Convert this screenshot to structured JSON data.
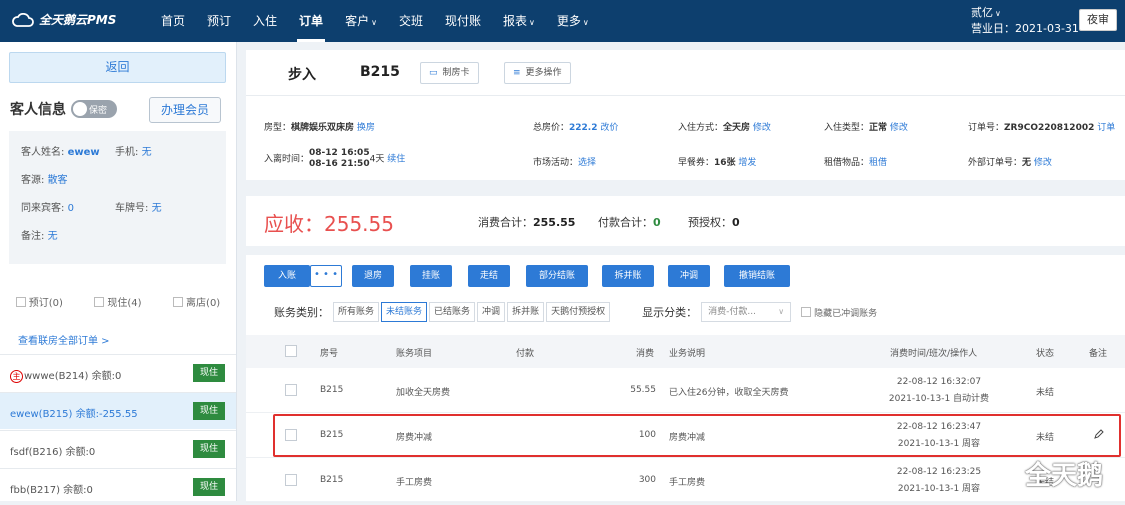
{
  "brand": {
    "name": "全天鹅云PMS"
  },
  "nav": [
    "首页",
    "预订",
    "入住",
    "订单",
    "客户",
    "交班",
    "现付账",
    "报表",
    "更多"
  ],
  "user": {
    "name": "贰亿",
    "business_date": "营业日：2021-03-31",
    "night_audit": "夜审"
  },
  "left": {
    "back": "返回",
    "guest_info": "客人信息",
    "privacy": "保密",
    "member": "办理会员",
    "name_label": "客人姓名:",
    "name": "ewew",
    "phone_label": "手机:",
    "phone": "无",
    "source_label": "客源:",
    "source": "散客",
    "companion_label": "同来宾客:",
    "companion": "0",
    "plate_label": "车牌号:",
    "plate": "无",
    "remark_label": "备注:",
    "remark": "无",
    "checks": [
      "预订(0)",
      "现住(4)",
      "离店(0)"
    ],
    "all_orders": "查看联房全部订单 >",
    "rooms": [
      {
        "prefix": "主",
        "text": "wwwe(B214)  余额:0",
        "tag": "现住"
      },
      {
        "prefix": "",
        "text": "ewew(B215)  余额:-255.55",
        "tag": "现住"
      },
      {
        "prefix": "",
        "text": "fsdf(B216)  余额:0",
        "tag": "现住"
      },
      {
        "prefix": "",
        "text": "fbb(B217)  余额:0",
        "tag": "现住"
      }
    ]
  },
  "header": {
    "status": "步入",
    "room": "B215",
    "make_card": "制房卡",
    "more_ops": "更多操作"
  },
  "details": {
    "room_type_label": "房型：",
    "room_type": "棋牌娱乐双床房",
    "change_room": "换房",
    "price_label": "总房价：",
    "price": "222.2",
    "change_price": "改价",
    "checkin_method_label": "入住方式：",
    "checkin_method": "全天房",
    "edit1": "修改",
    "checkin_type_label": "入住类型：",
    "checkin_type": "正常",
    "edit2": "修改",
    "order_no_label": "订单号：",
    "order_no": "ZR9CO220812002",
    "order_link": "订单",
    "time_label": "入离时间：",
    "time_in": "08-12 16:05",
    "time_out": "08-16 21:50",
    "nights": "4天",
    "extend": "续住",
    "market_label": "市场活动：",
    "market": "选择",
    "breakfast_label": "早餐券：",
    "breakfast": "16张",
    "add": "增发",
    "borrow_label": "租借物品：",
    "borrow": "租借",
    "ext_order_label": "外部订单号：",
    "ext_order": "无",
    "edit3": "修改"
  },
  "summary": {
    "receivable": "应收：255.55",
    "consume_label": "消费合计：",
    "consume": "255.55",
    "pay_label": "付款合计：",
    "pay": "0",
    "preauth_label": "预授权：",
    "preauth": "0"
  },
  "buttons": [
    "入账",
    "退房",
    "挂账",
    "走结",
    "部分结账",
    "拆并账",
    "冲调",
    "撤销结账"
  ],
  "more_dots": "• • •",
  "filters": {
    "type_label": "账务类别：",
    "types": [
      "所有账务",
      "未结账务",
      "已结账务",
      "冲调",
      "拆并账",
      "天鹅付预授权"
    ],
    "show_label": "显示分类：",
    "show_value": "消费-付款...",
    "hide_label": "隐藏已冲调账务"
  },
  "table": {
    "headers": [
      "房号",
      "账务项目",
      "付款",
      "消费",
      "业务说明",
      "消费时间/班次/操作人",
      "状态",
      "备注"
    ],
    "rows": [
      {
        "room": "B215",
        "item": "加收全天房费",
        "pay": "",
        "consume": "55.55",
        "desc": "已入住26分钟，收取全天房费",
        "time": "22-08-12 16:32:07",
        "shift": "2021-10-13-1 自动计费",
        "status": "未结"
      },
      {
        "room": "B215",
        "item": "房费冲减",
        "pay": "",
        "consume": "100",
        "desc": "房费冲减",
        "time": "22-08-12 16:23:47",
        "shift": "2021-10-13-1 周容",
        "status": "未结"
      },
      {
        "room": "B215",
        "item": "手工房费",
        "pay": "",
        "consume": "300",
        "desc": "手工房费",
        "time": "22-08-12 16:23:25",
        "shift": "2021-10-13-1 周容",
        "status": "未结"
      }
    ]
  },
  "watermark": "全天鹅",
  "colors": {
    "nav_bg": "#0d3f6e",
    "accent": "#2d7ad6",
    "receivable": "#e8504f",
    "stay_tag": "#2e8b3f",
    "highlight": "#e0302e"
  }
}
